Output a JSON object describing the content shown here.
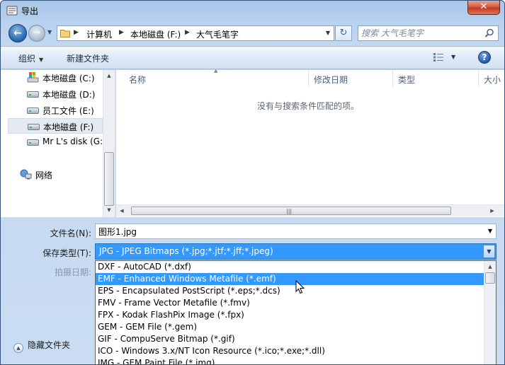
{
  "window": {
    "title": "导出",
    "close_label": "✕"
  },
  "address": {
    "crumbs": [
      "计算机",
      "本地磁盘 (F:)",
      "大气毛笔字"
    ],
    "search_placeholder": "搜索 大气毛笔字"
  },
  "toolbar": {
    "organize_label": "组织",
    "new_folder_label": "新建文件夹",
    "help_label": "?"
  },
  "nav_pane": {
    "items": [
      {
        "label": "本地磁盘 (C:)",
        "icon": "system-drive-icon"
      },
      {
        "label": "本地磁盘 (D:)",
        "icon": "drive-icon"
      },
      {
        "label": "员工文件 (E:)",
        "icon": "drive-icon"
      },
      {
        "label": "本地磁盘 (F:)",
        "icon": "drive-icon",
        "selected": true
      },
      {
        "label": "Mr L's disk (G:",
        "icon": "drive-icon"
      },
      {
        "label": "网络",
        "icon": "network-icon"
      }
    ]
  },
  "file_list": {
    "columns": [
      "名称",
      "修改日期",
      "类型",
      "大小"
    ],
    "empty_message": "没有与搜索条件匹配的项。"
  },
  "form": {
    "filename_label": "文件名(N):",
    "filename_value": "图形1.jpg",
    "filetype_label": "保存类型(T):",
    "filetype_value": "JPG - JPEG Bitmaps (*.jpg;*.jtf;*.jff;*.jpeg)",
    "date_label": "拍摄日期:",
    "hide_folders_label": "隐藏文件夹"
  },
  "filetype_options": [
    "DXF - AutoCAD (*.dxf)",
    "EMF - Enhanced Windows Metafile (*.emf)",
    "EPS - Encapsulated PostScript (*.eps;*.dcs)",
    "FMV - Frame Vector Metafile (*.fmv)",
    "FPX - Kodak FlashPix Image (*.fpx)",
    "GEM - GEM File (*.gem)",
    "GIF - CompuServe Bitmap (*.gif)",
    "ICO - Windows 3.x/NT Icon Resource (*.ico;*.exe;*.dll)",
    "IMG - GEM Paint File (*.img)"
  ],
  "highlighted_option_index": 1,
  "colors": {
    "selection": "#3399ff",
    "frame": "#c2d8f1"
  }
}
